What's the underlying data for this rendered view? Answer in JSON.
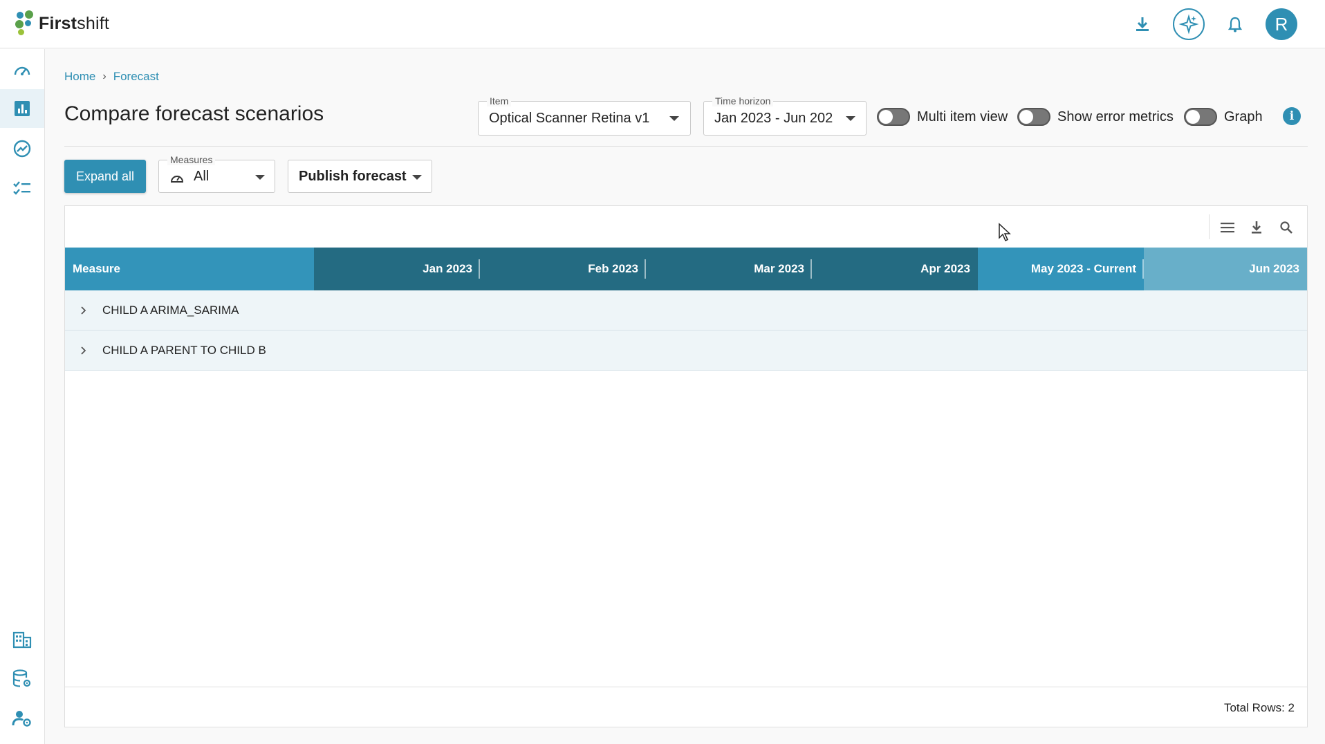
{
  "app": {
    "logo_bold": "First",
    "logo_light": "shift",
    "brand_color": "#2f8fb3",
    "avatar_initial": "R",
    "top_icons": [
      "download-icon",
      "ai-sparkle-icon",
      "bell-icon"
    ]
  },
  "sidebar": {
    "items": [
      {
        "icon": "dashboard-gauge-icon",
        "active": false
      },
      {
        "icon": "bar-chart-icon",
        "active": true
      },
      {
        "icon": "trend-circle-icon",
        "active": false
      },
      {
        "icon": "checklist-icon",
        "active": false
      },
      {
        "icon": "building-icon",
        "active": false
      },
      {
        "icon": "database-settings-icon",
        "active": false
      },
      {
        "icon": "user-settings-icon",
        "active": false
      }
    ]
  },
  "breadcrumb": {
    "home": "Home",
    "separator": "›",
    "current": "Forecast"
  },
  "page": {
    "title": "Compare forecast scenarios"
  },
  "filters": {
    "item": {
      "label": "Item",
      "value": "Optical Scanner Retina v1"
    },
    "time_horizon": {
      "label": "Time horizon",
      "value": "Jan 2023 - Jun 202"
    },
    "toggles": [
      {
        "label": "Multi item view",
        "on": false
      },
      {
        "label": "Show error metrics",
        "on": false
      },
      {
        "label": "Graph",
        "on": false
      }
    ],
    "info_glyph": "i"
  },
  "toolbar": {
    "expand_all": "Expand all",
    "measures": {
      "label": "Measures",
      "value": "All"
    },
    "publish": "Publish forecast"
  },
  "grid": {
    "toolbar_icons": [
      "columns-menu-icon",
      "export-download-icon",
      "search-icon"
    ],
    "columns": [
      {
        "label": "Measure",
        "kind": "measure"
      },
      {
        "label": "Jan 2023",
        "kind": "past"
      },
      {
        "label": "Feb 2023",
        "kind": "past"
      },
      {
        "label": "Mar 2023",
        "kind": "past"
      },
      {
        "label": "Apr 2023",
        "kind": "past"
      },
      {
        "label": "May 2023 - Current",
        "kind": "current"
      },
      {
        "label": "Jun 2023",
        "kind": "future"
      }
    ],
    "rows": [
      {
        "label": "CHILD A ARIMA_SARIMA"
      },
      {
        "label": "CHILD A PARENT TO CHILD B"
      }
    ],
    "footer": "Total Rows: 2"
  }
}
